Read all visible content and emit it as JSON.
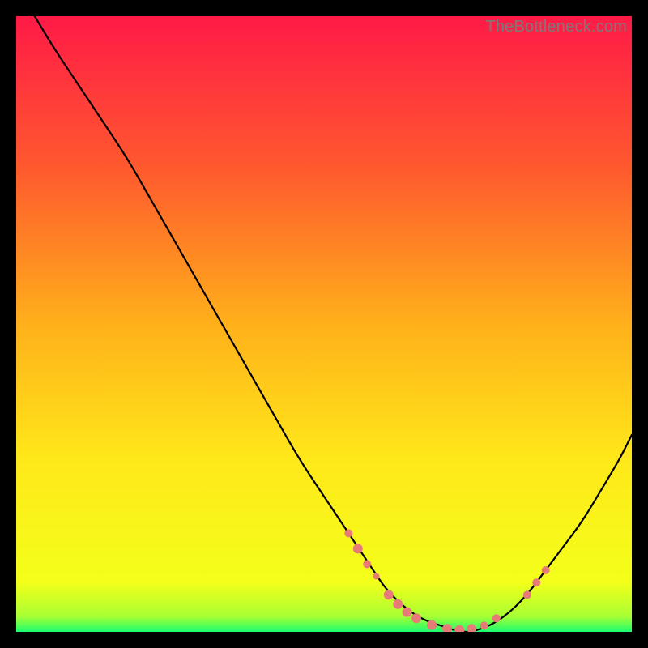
{
  "watermark": "TheBottleneck.com",
  "chart_data": {
    "type": "line",
    "title": "",
    "xlabel": "",
    "ylabel": "",
    "xlim": [
      0,
      100
    ],
    "ylim": [
      0,
      100
    ],
    "grid": false,
    "legend": false,
    "background_gradient": {
      "stops": [
        {
          "offset": 0.0,
          "color": "#ff1a47"
        },
        {
          "offset": 0.25,
          "color": "#ff5a2e"
        },
        {
          "offset": 0.5,
          "color": "#ffb01a"
        },
        {
          "offset": 0.72,
          "color": "#ffe81a"
        },
        {
          "offset": 0.92,
          "color": "#f3ff1a"
        },
        {
          "offset": 0.975,
          "color": "#a8ff33"
        },
        {
          "offset": 1.0,
          "color": "#1aff70"
        }
      ]
    },
    "series": [
      {
        "name": "bottleneck-curve",
        "color": "#000000",
        "x": [
          3,
          6,
          10,
          14,
          18,
          22,
          26,
          30,
          34,
          38,
          42,
          46,
          50,
          54,
          58,
          60,
          63,
          66,
          69,
          72,
          74,
          77,
          80,
          83,
          86,
          89,
          92,
          95,
          98,
          100
        ],
        "y": [
          100,
          95,
          89,
          83,
          77,
          70,
          63,
          56,
          49,
          42,
          35,
          28,
          22,
          16,
          10,
          7,
          4,
          2,
          1,
          0,
          0,
          1,
          3,
          6,
          10,
          14,
          18,
          23,
          28,
          32
        ]
      }
    ],
    "markers": {
      "name": "curve-dots",
      "color": "#e77b77",
      "points": [
        {
          "x": 54,
          "y": 16,
          "r": 5
        },
        {
          "x": 55.5,
          "y": 13.5,
          "r": 6
        },
        {
          "x": 57,
          "y": 11,
          "r": 5
        },
        {
          "x": 58.5,
          "y": 9,
          "r": 4
        },
        {
          "x": 60.5,
          "y": 6,
          "r": 6
        },
        {
          "x": 62,
          "y": 4.5,
          "r": 6
        },
        {
          "x": 63.5,
          "y": 3.2,
          "r": 6
        },
        {
          "x": 65,
          "y": 2.2,
          "r": 6
        },
        {
          "x": 67.5,
          "y": 1.1,
          "r": 6
        },
        {
          "x": 70,
          "y": 0.5,
          "r": 6
        },
        {
          "x": 72,
          "y": 0.3,
          "r": 6
        },
        {
          "x": 74,
          "y": 0.5,
          "r": 6
        },
        {
          "x": 76,
          "y": 1.0,
          "r": 5
        },
        {
          "x": 78,
          "y": 2.2,
          "r": 5
        },
        {
          "x": 83,
          "y": 6,
          "r": 5
        },
        {
          "x": 84.5,
          "y": 8,
          "r": 5
        },
        {
          "x": 86,
          "y": 10,
          "r": 5
        }
      ]
    }
  }
}
